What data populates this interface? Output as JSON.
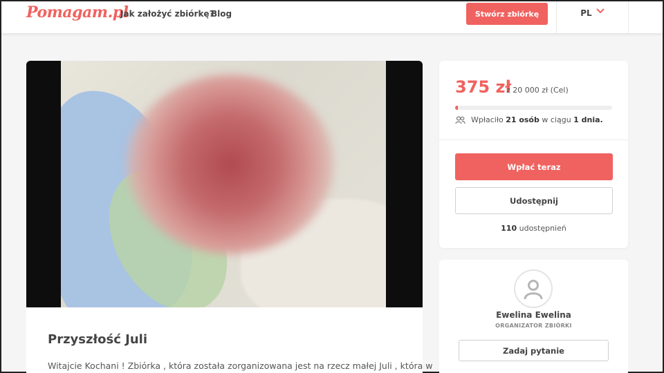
{
  "header": {
    "logo": "Pomagam.pl",
    "nav": {
      "how_to": "Jak założyć zbiórkę?",
      "blog": "Blog"
    },
    "create_button": "Stwórz zbiórkę",
    "language": "PL",
    "icons": {
      "language_chevron": "chevron-down-icon"
    }
  },
  "campaign": {
    "title": "Przyszłość Juli",
    "intro": "Witajcie Kochani ! Zbiórka , która została zorganizowana jest na rzecz małej Juli , która w"
  },
  "donation": {
    "amount": "375 zł",
    "goal": "z 20 000 zł (Cel)",
    "progress_fraction": 0.01875,
    "donors_prefix": "Wpłaciło",
    "donors_count": "21 osób",
    "donors_middle": "w ciągu",
    "donors_period": "1 dnia.",
    "pay_button": "Wpłać teraz",
    "share_button": "Udostępnij",
    "shares_count": "110",
    "shares_label": "udostępnień"
  },
  "organizer": {
    "name": "Ewelina Ewelina",
    "role": "ORGANIZATOR ZBIÓRKI",
    "ask_button": "Zadaj pytanie"
  },
  "colors": {
    "accent": "#f0625f",
    "background": "#f5f5f5"
  }
}
